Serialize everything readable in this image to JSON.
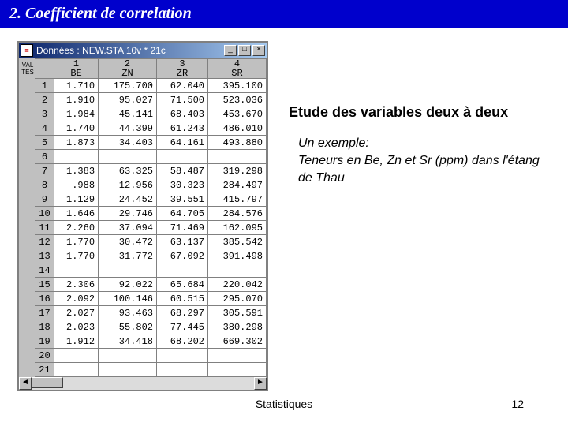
{
  "slide": {
    "title": "2. Coefficient de correlation",
    "footer_center": "Statistiques",
    "page_number": "12"
  },
  "right": {
    "heading": "Etude des variables deux à deux",
    "example_label": "Un exemple:",
    "example_body": "Teneurs en Be, Zn et Sr (ppm) dans l'étang de Thau"
  },
  "window": {
    "title": "Données : NEW.STA 10v * 21c",
    "left_label": "VAL TES",
    "icon_glyph": "≡",
    "buttons": {
      "min": "_",
      "max": "□",
      "close": "×"
    },
    "scroll": {
      "left": "◄",
      "right": "►"
    },
    "columns": [
      {
        "num": "1",
        "name": "BE"
      },
      {
        "num": "2",
        "name": "ZN"
      },
      {
        "num": "3",
        "name": "ZR"
      },
      {
        "num": "4",
        "name": "SR"
      }
    ],
    "rows": [
      {
        "n": "1",
        "c": [
          "1.710",
          "175.700",
          "62.040",
          "395.100"
        ]
      },
      {
        "n": "2",
        "c": [
          "1.910",
          "95.027",
          "71.500",
          "523.036"
        ]
      },
      {
        "n": "3",
        "c": [
          "1.984",
          "45.141",
          "68.403",
          "453.670"
        ]
      },
      {
        "n": "4",
        "c": [
          "1.740",
          "44.399",
          "61.243",
          "486.010"
        ]
      },
      {
        "n": "5",
        "c": [
          "1.873",
          "34.403",
          "64.161",
          "493.880"
        ]
      },
      {
        "n": "6",
        "c": [
          "",
          "",
          "",
          ""
        ]
      },
      {
        "n": "7",
        "c": [
          "1.383",
          "63.325",
          "58.487",
          "319.298"
        ]
      },
      {
        "n": "8",
        "c": [
          ".988",
          "12.956",
          "30.323",
          "284.497"
        ]
      },
      {
        "n": "9",
        "c": [
          "1.129",
          "24.452",
          "39.551",
          "415.797"
        ]
      },
      {
        "n": "10",
        "c": [
          "1.646",
          "29.746",
          "64.705",
          "284.576"
        ]
      },
      {
        "n": "11",
        "c": [
          "2.260",
          "37.094",
          "71.469",
          "162.095"
        ]
      },
      {
        "n": "12",
        "c": [
          "1.770",
          "30.472",
          "63.137",
          "385.542"
        ]
      },
      {
        "n": "13",
        "c": [
          "1.770",
          "31.772",
          "67.092",
          "391.498"
        ]
      },
      {
        "n": "14",
        "c": [
          "",
          "",
          "",
          ""
        ]
      },
      {
        "n": "15",
        "c": [
          "2.306",
          "92.022",
          "65.684",
          "220.042"
        ]
      },
      {
        "n": "16",
        "c": [
          "2.092",
          "100.146",
          "60.515",
          "295.070"
        ]
      },
      {
        "n": "17",
        "c": [
          "2.027",
          "93.463",
          "68.297",
          "305.591"
        ]
      },
      {
        "n": "18",
        "c": [
          "2.023",
          "55.802",
          "77.445",
          "380.298"
        ]
      },
      {
        "n": "19",
        "c": [
          "1.912",
          "34.418",
          "68.202",
          "669.302"
        ]
      },
      {
        "n": "20",
        "c": [
          "",
          "",
          "",
          ""
        ]
      },
      {
        "n": "21",
        "c": [
          "",
          "",
          "",
          ""
        ]
      }
    ]
  },
  "chart_data": {
    "type": "table",
    "title": "Données : NEW.STA 10v * 21c",
    "columns": [
      "BE",
      "ZN",
      "ZR",
      "SR"
    ],
    "rows": [
      [
        1.71,
        175.7,
        62.04,
        395.1
      ],
      [
        1.91,
        95.027,
        71.5,
        523.036
      ],
      [
        1.984,
        45.141,
        68.403,
        453.67
      ],
      [
        1.74,
        44.399,
        61.243,
        486.01
      ],
      [
        1.873,
        34.403,
        64.161,
        493.88
      ],
      [
        null,
        null,
        null,
        null
      ],
      [
        1.383,
        63.325,
        58.487,
        319.298
      ],
      [
        0.988,
        12.956,
        30.323,
        284.497
      ],
      [
        1.129,
        24.452,
        39.551,
        415.797
      ],
      [
        1.646,
        29.746,
        64.705,
        284.576
      ],
      [
        2.26,
        37.094,
        71.469,
        162.095
      ],
      [
        1.77,
        30.472,
        63.137,
        385.542
      ],
      [
        1.77,
        31.772,
        67.092,
        391.498
      ],
      [
        null,
        null,
        null,
        null
      ],
      [
        2.306,
        92.022,
        65.684,
        220.042
      ],
      [
        2.092,
        100.146,
        60.515,
        295.07
      ],
      [
        2.027,
        93.463,
        68.297,
        305.591
      ],
      [
        2.023,
        55.802,
        77.445,
        380.298
      ],
      [
        1.912,
        34.418,
        68.202,
        669.302
      ],
      [
        null,
        null,
        null,
        null
      ],
      [
        null,
        null,
        null,
        null
      ]
    ]
  }
}
